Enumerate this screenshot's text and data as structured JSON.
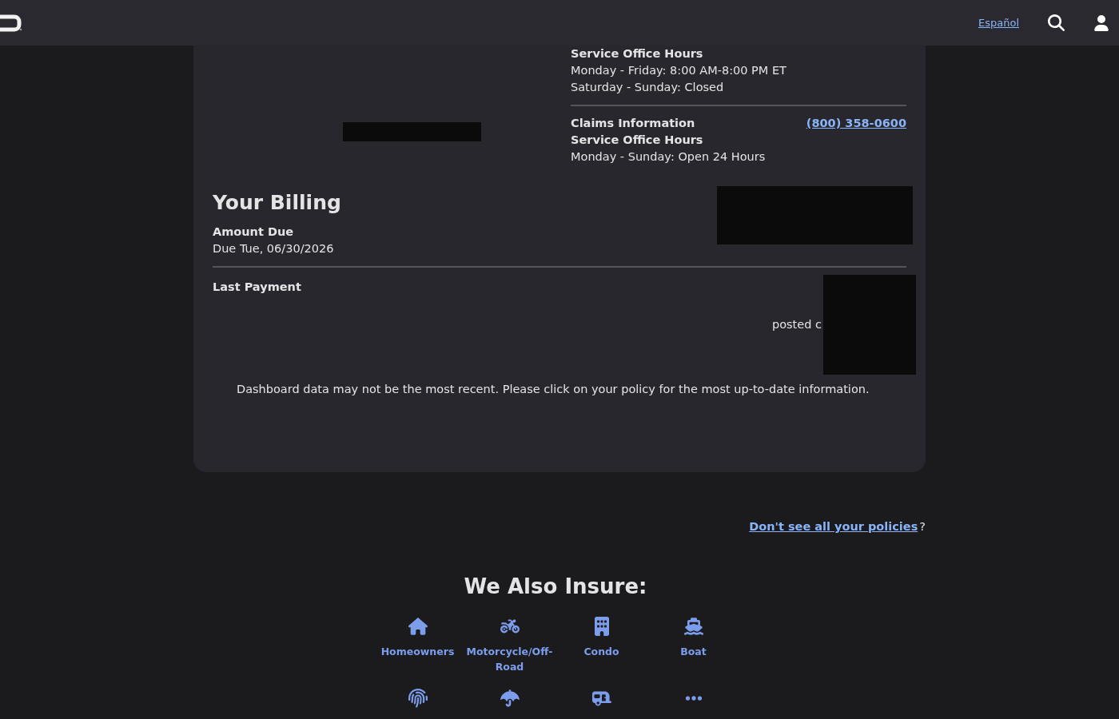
{
  "header": {
    "language_link": "Español"
  },
  "contact": {
    "service_hours_title": "Service Office Hours",
    "service_hours": [
      "Monday - Friday: 8:00 AM-8:00 PM ET",
      "Saturday - Sunday: Closed"
    ],
    "claims_title": "Claims Information",
    "claims_phone": "(800) 358-0600",
    "claims_hours_title": "Service Office Hours",
    "claims_hours": [
      "Monday - Sunday: Open 24 Hours"
    ]
  },
  "billing": {
    "title": "Your Billing",
    "amount_due_label": "Amount Due",
    "due_date": "Due Tue, 06/30/2026",
    "last_payment_label": "Last Payment",
    "last_payment_text": "posted c"
  },
  "notice": "Dashboard data may not be the most recent. Please click on your policy for the most up-to-date information.",
  "policies_link": {
    "text": "Don't see all your policies",
    "suffix": "?"
  },
  "also_insure": {
    "title": "We Also Insure:",
    "items": [
      {
        "kind": "house",
        "label": "Homeowners"
      },
      {
        "kind": "motorcycle",
        "label": "Motorcycle/Off-Road"
      },
      {
        "kind": "building",
        "label": "Condo"
      },
      {
        "kind": "boat",
        "label": "Boat"
      },
      {
        "kind": "fingerprint"
      },
      {
        "kind": "umbrella"
      },
      {
        "kind": "caravan"
      },
      {
        "kind": "dots"
      }
    ]
  }
}
